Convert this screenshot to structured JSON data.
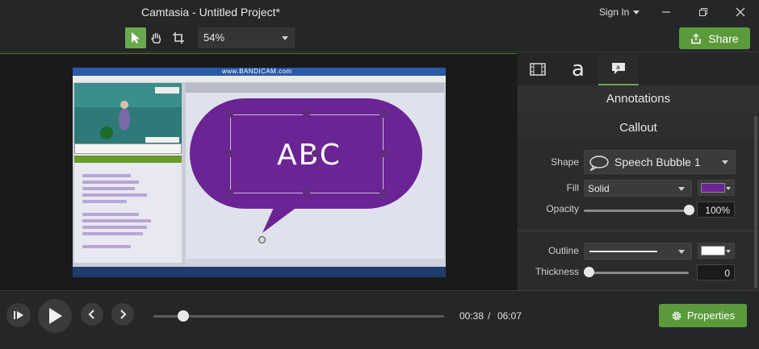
{
  "window": {
    "title": "Camtasia - Untitled Project*",
    "signin_label": "Sign In"
  },
  "toolbar": {
    "zoom_value": "54%",
    "share_label": "Share"
  },
  "canvas": {
    "watermark": "www.BANDICAM.com",
    "annotation_text": "ABC",
    "bubble_color": "#6b2494"
  },
  "panel": {
    "tabs": [
      {
        "name": "media-tab",
        "icon": "film-icon"
      },
      {
        "name": "annotations-tab",
        "icon": "text-a-icon",
        "label": "a"
      },
      {
        "name": "callout-tab",
        "icon": "callout-bubble-icon",
        "label": "a"
      }
    ],
    "section_title": "Annotations",
    "subsection_title": "Callout",
    "shape_label": "Shape",
    "shape_value": "Speech Bubble 1",
    "fill_label": "Fill",
    "fill_value": "Solid",
    "fill_color": "#6b2494",
    "opacity_label": "Opacity",
    "opacity_value": "100%",
    "opacity_fraction": 1.0,
    "outline_label": "Outline",
    "outline_color": "#ffffff",
    "thickness_label": "Thickness",
    "thickness_value": "0"
  },
  "playback": {
    "current_time": "00:38",
    "separator": "/",
    "total_time": "06:07",
    "properties_label": "Properties",
    "progress_fraction": 0.104
  },
  "colors": {
    "accent": "#6aa84f",
    "button_green": "#5a9a3a"
  }
}
